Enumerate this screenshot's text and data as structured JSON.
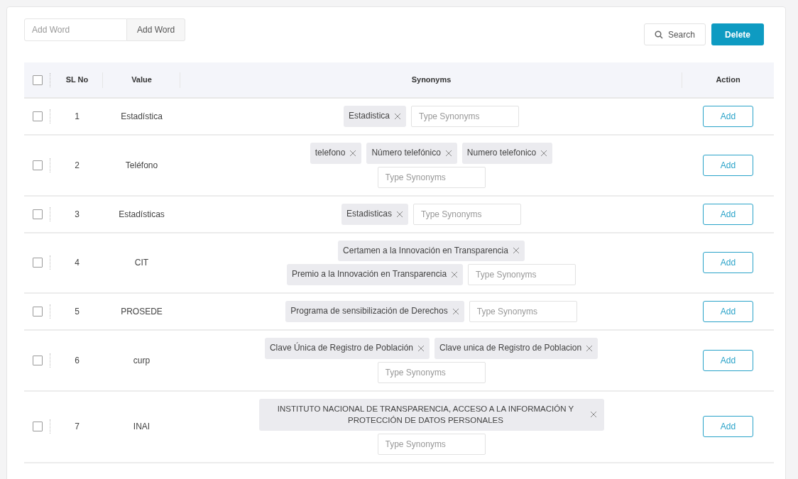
{
  "add_word": {
    "placeholder": "Add Word",
    "button": "Add Word"
  },
  "search_button": "Search",
  "delete_button": "Delete",
  "table": {
    "select_all": {
      "checked": false
    },
    "columns": [
      "SL No",
      "Value",
      "Synonyms",
      "Action"
    ],
    "rows": [
      {
        "checked": false,
        "sl_no": "1",
        "value": "Estadística",
        "synonyms": [
          "Estadistica"
        ],
        "placeholder": "Type Synonyms",
        "action": "Add"
      },
      {
        "checked": false,
        "sl_no": "2",
        "value": "Teléfono",
        "synonyms": [
          "telefono",
          "Número telefónico",
          "Numero telefonico"
        ],
        "placeholder": "Type Synonyms",
        "action": "Add"
      },
      {
        "checked": false,
        "sl_no": "3",
        "value": "Estadísticas",
        "synonyms": [
          "Estadisticas"
        ],
        "placeholder": "Type Synonyms",
        "action": "Add"
      },
      {
        "checked": false,
        "sl_no": "4",
        "value": "CIT",
        "synonyms": [
          "Certamen a la Innovación en Transparencia",
          "Premio a la Innovación en Transparencia"
        ],
        "placeholder": "Type Synonyms",
        "action": "Add"
      },
      {
        "checked": false,
        "sl_no": "5",
        "value": "PROSEDE",
        "synonyms": [
          "Programa de sensibilización de Derechos"
        ],
        "placeholder": "Type Synonyms",
        "action": "Add"
      },
      {
        "checked": false,
        "sl_no": "6",
        "value": "curp",
        "synonyms": [
          "Clave Única de Registro de Población",
          "Clave unica de Registro de Poblacion"
        ],
        "placeholder": "Type Synonyms",
        "action": "Add"
      },
      {
        "checked": false,
        "sl_no": "7",
        "value": "INAI",
        "synonyms": [
          "INSTITUTO NACIONAL DE TRANSPARENCIA, ACCESO A LA INFORMACIÓN Y PROTECCIÓN DE DATOS PERSONALES"
        ],
        "placeholder": "Type Synonyms",
        "action": "Add"
      }
    ]
  }
}
